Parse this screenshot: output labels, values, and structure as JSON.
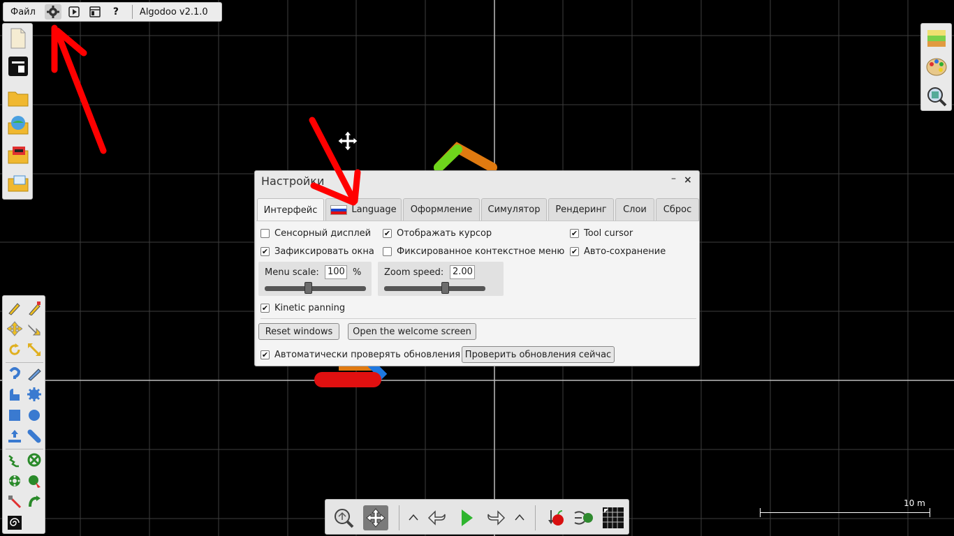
{
  "topbar": {
    "file_menu": "Файл",
    "icons": [
      "gear-icon",
      "play-icon",
      "window-icon",
      "help-icon"
    ],
    "help_label": "?",
    "version": "Algodoo v2.1.0"
  },
  "settings_dialog": {
    "title": "Настройки",
    "minimize": "–",
    "close": "×",
    "tabs": [
      {
        "label": "Интерфейс",
        "active": true
      },
      {
        "label": "Language",
        "flag": "ru"
      },
      {
        "label": "Оформление"
      },
      {
        "label": "Симулятор"
      },
      {
        "label": "Рендеринг"
      },
      {
        "label": "Слои"
      },
      {
        "label": "Сброс"
      }
    ],
    "interface": {
      "touch_display": {
        "label": "Сенсорный дисплей",
        "checked": false
      },
      "show_cursor": {
        "label": "Отображать курсор",
        "checked": true
      },
      "tool_cursor": {
        "label": "Tool cursor",
        "checked": true
      },
      "lock_windows": {
        "label": "Зафиксировать окна",
        "checked": true
      },
      "fixed_context_menu": {
        "label": "Фиксированное контекстное меню",
        "checked": false
      },
      "auto_save": {
        "label": "Авто-сохранение",
        "checked": true
      },
      "menu_scale": {
        "label": "Menu scale:",
        "value": "100",
        "unit": "%",
        "slider_fraction": 0.43
      },
      "zoom_speed": {
        "label": "Zoom speed:",
        "value": "2.00",
        "slider_fraction": 0.6
      },
      "kinetic_panning": {
        "label": "Kinetic panning",
        "checked": true
      },
      "reset_windows": "Reset windows",
      "open_welcome": "Open the welcome screen",
      "auto_check_updates": {
        "label": "Автоматически проверять обновления",
        "checked": true
      },
      "check_updates_now": "Проверить обновления сейчас"
    }
  },
  "scale": {
    "label": "10 m"
  },
  "colors": {
    "background": "#000000",
    "grid": "#5a5a5a",
    "panel": "#e9e9e9",
    "annotation_arrow": "#ff0000",
    "play_green": "#2fb52f"
  }
}
